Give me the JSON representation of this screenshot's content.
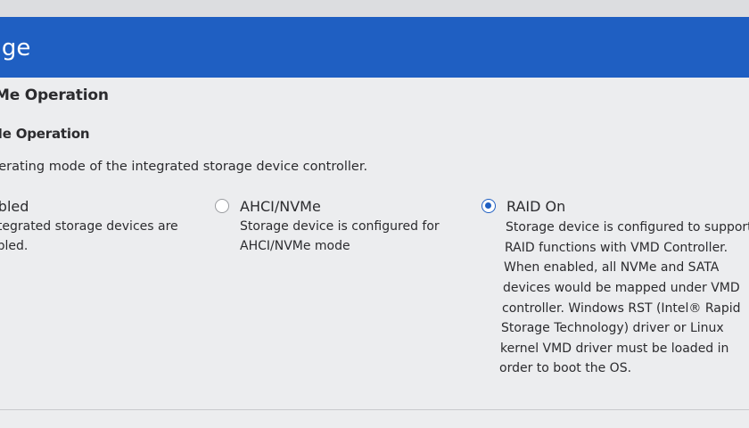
{
  "header": {
    "title": "age"
  },
  "section": {
    "title": "/Me Operation",
    "subtitle": "Me Operation",
    "description": "perating mode of the integrated storage device controller."
  },
  "options": [
    {
      "label": "abled",
      "selected": false,
      "description": [
        "ntegrated storage devices are",
        "abled."
      ]
    },
    {
      "label": "AHCI/NVMe",
      "selected": false,
      "description": [
        "Storage device is configured for",
        "AHCI/NVMe mode"
      ]
    },
    {
      "label": "RAID On",
      "selected": true,
      "description": [
        "Storage device is configured to support",
        "RAID functions with VMD Controller.",
        "When enabled, all NVMe and SATA",
        "devices would be mapped under VMD",
        "controller. Windows RST (Intel® Rapid",
        "Storage Technology) driver or Linux",
        "kernel VMD driver must be loaded in",
        "order to boot the OS."
      ]
    }
  ],
  "colors": {
    "accent": "#1f5fc2",
    "background": "#ecedef",
    "text": "#2b2b2e"
  }
}
